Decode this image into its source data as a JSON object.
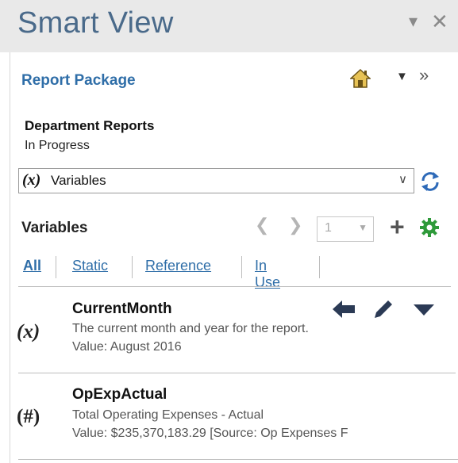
{
  "window": {
    "title": "Smart View",
    "menu_icon": "chevron-down-icon",
    "close_icon": "close-icon"
  },
  "report_package": {
    "title": "Report Package",
    "home_icon": "home-icon",
    "more_icon": "double-chevron-right-icon",
    "name": "Department Reports",
    "status": "In Progress"
  },
  "selector": {
    "symbol": "(x)",
    "selected": "Variables",
    "refresh_icon": "refresh-icon"
  },
  "variables": {
    "heading": "Variables",
    "page": "1",
    "filters": [
      "All",
      "Static",
      "Reference",
      "In Use"
    ],
    "active_filter": "All",
    "items": [
      {
        "symbol": "(x)",
        "name": "CurrentMonth",
        "description": "The current month and year for the report.",
        "value": "Value: August 2016",
        "actions": [
          "arrow-left-icon",
          "pencil-icon",
          "caret-down-icon"
        ]
      },
      {
        "symbol": "(#)",
        "name": "OpExpActual",
        "description": "Total Operating Expenses - Actual",
        "value": "Value:  $235,370,183.29  [Source: Op Expenses F"
      }
    ]
  },
  "colors": {
    "accent": "#2f6ea8",
    "title_text": "#4a6a8a",
    "gear_green": "#2f9a3a"
  }
}
